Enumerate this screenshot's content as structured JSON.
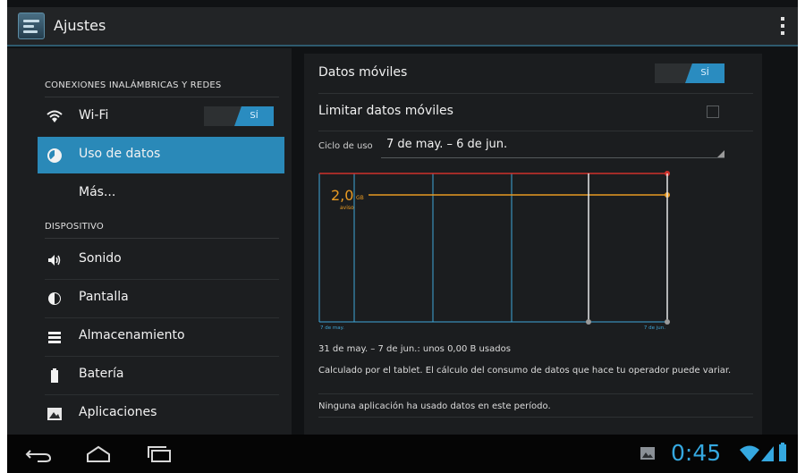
{
  "app_bar": {
    "title": "Ajustes",
    "icon": "settings-sliders-icon",
    "menu_icon": "overflow-menu-icon"
  },
  "sidebar": {
    "sections": [
      {
        "header": "CONEXIONES INALÁMBRICAS Y REDES"
      },
      {
        "header": "DISPOSITIVO"
      }
    ],
    "items": [
      {
        "label": "Wi-Fi",
        "icon": "wifi-icon",
        "toggle": "SÍ"
      },
      {
        "label": "Uso de datos",
        "icon": "data-usage-icon",
        "selected": true
      },
      {
        "label": "Más..."
      },
      {
        "label": "Sonido",
        "icon": "speaker-icon"
      },
      {
        "label": "Pantalla",
        "icon": "brightness-icon"
      },
      {
        "label": "Almacenamiento",
        "icon": "storage-icon"
      },
      {
        "label": "Batería",
        "icon": "battery-icon"
      },
      {
        "label": "Aplicaciones",
        "icon": "apps-icon"
      }
    ]
  },
  "detail": {
    "mobile_data_label": "Datos móviles",
    "mobile_data_toggle": "SÍ",
    "limit_label": "Limitar datos móviles",
    "limit_checked": false,
    "cycle_label": "Ciclo de uso",
    "cycle_value": "7 de may. – 6 de jun.",
    "usage_summary": "31 de may. – 7 de jun.: unos 0,00 B usados",
    "note": "Calculado por el tablet. El cálculo del consumo de datos que hace tu operador puede variar.",
    "no_apps": "Ninguna aplicación ha usado datos en este período."
  },
  "chart_data": {
    "type": "line",
    "warning_value": "2,0",
    "warning_unit": "GB",
    "warning_label": "aviso",
    "x_start_label": "7 de may.",
    "x_end_label": "7 de jun.",
    "colors": {
      "limit": "#d0322c",
      "warning": "#e89a22",
      "grid": "#3fa6d8",
      "range": "#e8e8e8"
    }
  },
  "status_bar": {
    "time": "0:45",
    "nav": [
      "back-icon",
      "home-icon",
      "recent-apps-icon"
    ],
    "status_icons": [
      "gallery-notification-icon",
      "wifi-signal-icon",
      "cell-signal-icon",
      "battery-status-icon"
    ]
  }
}
